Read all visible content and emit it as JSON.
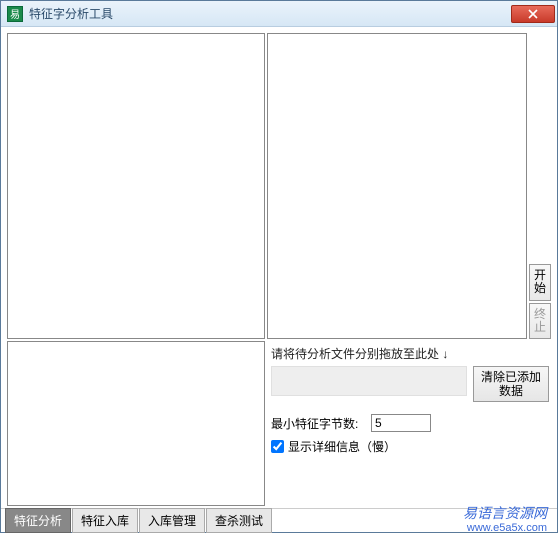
{
  "window": {
    "title": "特征字分析工具"
  },
  "side": {
    "start": "开\n始",
    "stop": "终\n止"
  },
  "drop": {
    "hint": "请将待分析文件分别拖放至此处 ↓",
    "clear": "清除已添加\n数据"
  },
  "fields": {
    "min_bytes_label": "最小特征字节数:",
    "min_bytes_value": "5",
    "verbose_label": "显示详细信息（慢）",
    "verbose_checked": true
  },
  "tabs": [
    "特征分析",
    "特征入库",
    "入库管理",
    "查杀测试"
  ],
  "active_tab": 0,
  "brand": {
    "cn": "易语言资源网",
    "url": "www.e5a5x.com"
  }
}
